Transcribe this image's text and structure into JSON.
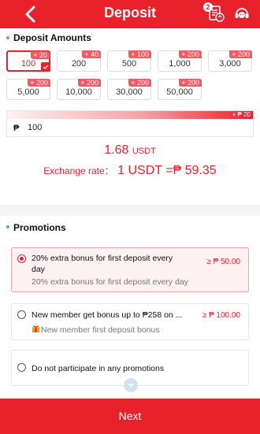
{
  "header": {
    "title": "Deposit",
    "badge_count": "2",
    "icons": [
      "back-icon",
      "bill-icon",
      "support-icon"
    ]
  },
  "deposit": {
    "section_title": "Deposit Amounts",
    "chips": [
      {
        "value": "100",
        "bonus": "+ 20",
        "selected": true
      },
      {
        "value": "200",
        "bonus": "+ 40"
      },
      {
        "value": "500",
        "bonus": "+ 100"
      },
      {
        "value": "1,000",
        "bonus": "+ 200"
      },
      {
        "value": "3,000",
        "bonus": "+ 200"
      },
      {
        "value": "5,000",
        "bonus": "+ 200"
      },
      {
        "value": "10,000",
        "bonus": "+ 200"
      },
      {
        "value": "30,000",
        "bonus": "+ 200"
      },
      {
        "value": "50,000",
        "bonus": "+ 200"
      }
    ],
    "input_bonus": "+ ₱ 20",
    "currency_symbol": "₱",
    "input_value": "100",
    "usdt_value": "1.68",
    "usdt_unit": "USDT",
    "rate_label": "Exchange rate：",
    "rate_value": "1 USDT =₱ 59.35"
  },
  "promotions": {
    "section_title": "Promotions",
    "items": [
      {
        "title": "20% extra bonus for first deposit every day",
        "subtitle": "20% extra bonus for first deposit every day",
        "amount": "≥ ₱ 50.00",
        "selected": true
      },
      {
        "title": "New member get bonus up to ₱258 on ...",
        "subtitle": "New member first deposit bonus",
        "amount": "≥ ₱ 100.00"
      },
      {
        "title": "Do not participate in any promotions"
      }
    ]
  },
  "footer": {
    "next_label": "Next"
  },
  "colors": {
    "brand": "#e8212b",
    "accent_dot": "#4da9e3"
  }
}
